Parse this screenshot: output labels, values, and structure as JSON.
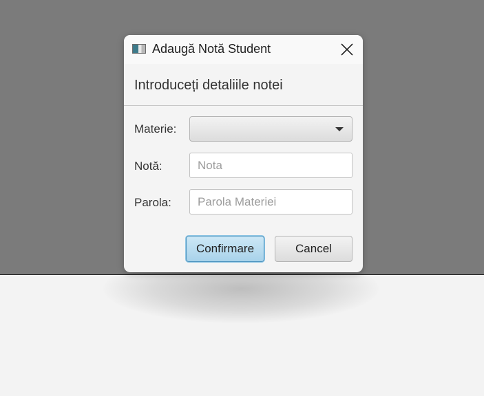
{
  "dialog": {
    "title": "Adaugă Notă Student",
    "header": "Introduceți detaliile notei",
    "fields": {
      "subject": {
        "label": "Materie:",
        "value": ""
      },
      "grade": {
        "label": "Notă:",
        "placeholder": "Nota",
        "value": ""
      },
      "password": {
        "label": "Parola:",
        "placeholder": "Parola Materiei",
        "value": ""
      }
    },
    "buttons": {
      "confirm": "Confirmare",
      "cancel": "Cancel"
    }
  },
  "icons": {
    "app": "app-window-icon",
    "close": "close-icon",
    "dropdown": "chevron-down-icon"
  }
}
